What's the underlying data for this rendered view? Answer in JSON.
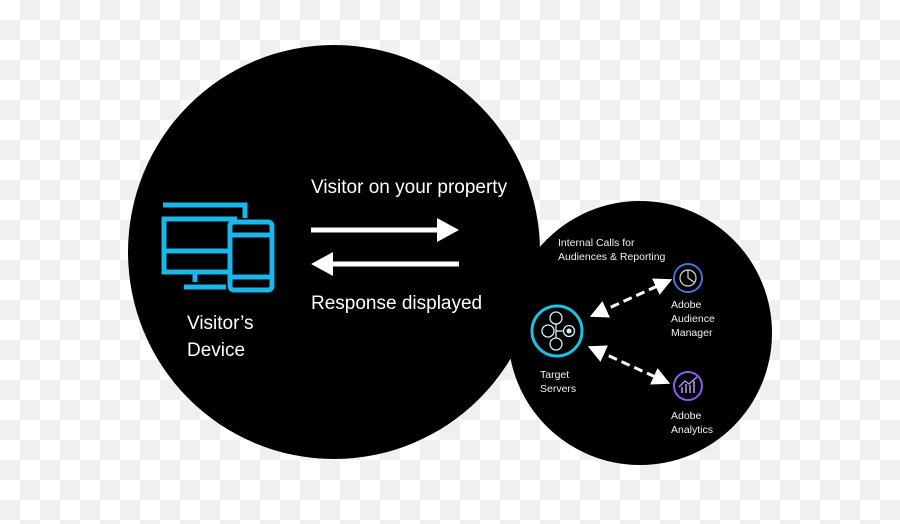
{
  "colors": {
    "background_circle": "#000000",
    "device_icon": "#1ab7ea",
    "target_ring": "#19c3e6",
    "audience_manager": "#4b6fd6",
    "analytics": "#8a5cf0",
    "arrows": "#ffffff"
  },
  "visitor_device": {
    "label_line1": "Visitor’s",
    "label_line2": "Device",
    "icon": "desktop-and-phone-icon"
  },
  "request_label": "Visitor on your property",
  "response_label": "Response displayed",
  "internal_calls": {
    "line1": "Internal Calls for",
    "line2": "Audiences & Reporting"
  },
  "target_servers": {
    "line1": "Target",
    "line2": "Servers",
    "icon": "network-nodes-icon"
  },
  "audience_manager": {
    "line1": "Adobe",
    "line2": "Audience",
    "line3": "Manager",
    "icon": "pie-chart-icon"
  },
  "analytics": {
    "line1": "Adobe",
    "line2": "Analytics",
    "icon": "bar-trend-icon"
  }
}
